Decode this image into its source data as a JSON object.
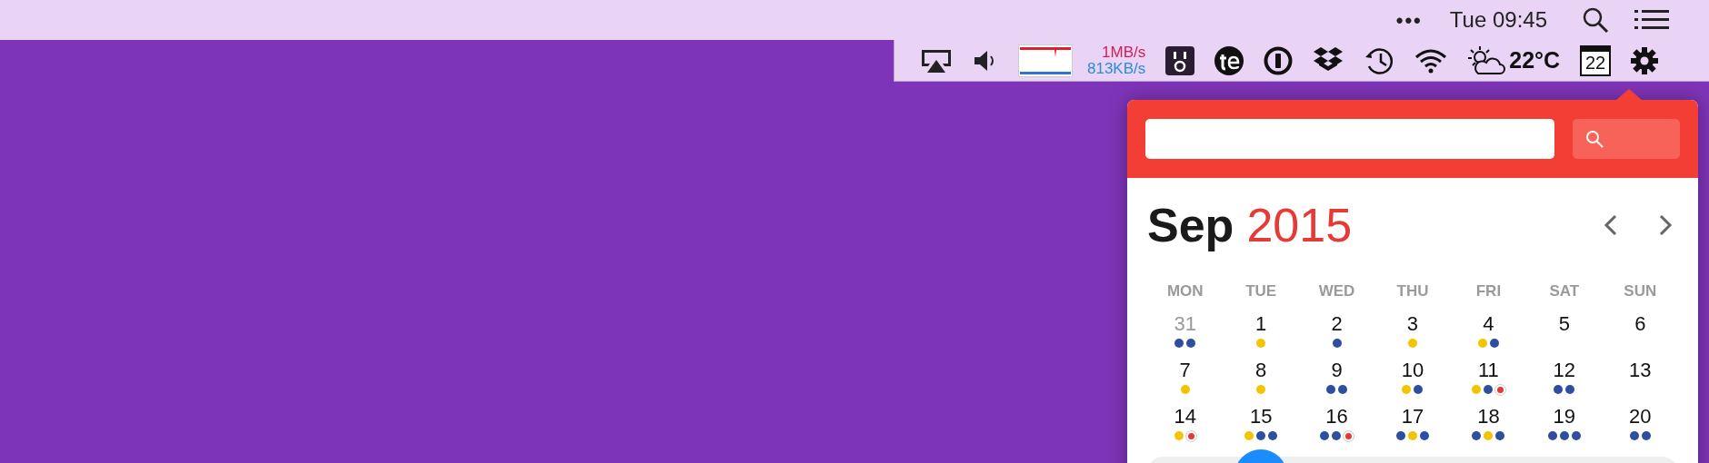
{
  "menu_bar": {
    "more": "•••",
    "clock": "Tue 09:45"
  },
  "status_bar": {
    "net_up": "1MB/s",
    "net_down": "813KB/s",
    "temperature": "22°C",
    "calendar_day": "22"
  },
  "calendar": {
    "month": "Sep",
    "year": "2015",
    "weekdays": [
      "MON",
      "TUE",
      "WED",
      "THU",
      "FRI",
      "SAT",
      "SUN"
    ],
    "weeks": [
      {
        "current": false,
        "days": [
          {
            "label": "31",
            "other_month": true,
            "selected": false,
            "dots": [
              {
                "kind": "dot",
                "color": "#2e4fa0"
              },
              {
                "kind": "dot",
                "color": "#2e4fa0"
              }
            ]
          },
          {
            "label": "1",
            "other_month": false,
            "selected": false,
            "dots": [
              {
                "kind": "dot",
                "color": "#f5c400"
              }
            ]
          },
          {
            "label": "2",
            "other_month": false,
            "selected": false,
            "dots": [
              {
                "kind": "dot",
                "color": "#2e4fa0"
              }
            ]
          },
          {
            "label": "3",
            "other_month": false,
            "selected": false,
            "dots": [
              {
                "kind": "dot",
                "color": "#f5c400"
              }
            ]
          },
          {
            "label": "4",
            "other_month": false,
            "selected": false,
            "dots": [
              {
                "kind": "dot",
                "color": "#f5c400"
              },
              {
                "kind": "dot",
                "color": "#2e4fa0"
              }
            ]
          },
          {
            "label": "5",
            "other_month": false,
            "selected": false
          },
          {
            "label": "6",
            "other_month": false,
            "selected": false
          }
        ]
      },
      {
        "current": false,
        "days": [
          {
            "label": "7",
            "other_month": false,
            "selected": false,
            "dots": [
              {
                "kind": "dot",
                "color": "#f5c400"
              }
            ]
          },
          {
            "label": "8",
            "other_month": false,
            "selected": false,
            "dots": [
              {
                "kind": "dot",
                "color": "#f5c400"
              }
            ]
          },
          {
            "label": "9",
            "other_month": false,
            "selected": false,
            "dots": [
              {
                "kind": "dot",
                "color": "#2e4fa0"
              },
              {
                "kind": "dot",
                "color": "#2e4fa0"
              }
            ]
          },
          {
            "label": "10",
            "other_month": false,
            "selected": false,
            "dots": [
              {
                "kind": "dot",
                "color": "#f5c400"
              },
              {
                "kind": "dot",
                "color": "#2e4fa0"
              }
            ]
          },
          {
            "label": "11",
            "other_month": false,
            "selected": false,
            "dots": [
              {
                "kind": "dot",
                "color": "#f5c400"
              },
              {
                "kind": "dot",
                "color": "#2e4fa0"
              },
              {
                "kind": "ring",
                "color": "#e53935"
              }
            ]
          },
          {
            "label": "12",
            "other_month": false,
            "selected": false,
            "dots": [
              {
                "kind": "dot",
                "color": "#2e4fa0"
              },
              {
                "kind": "dot",
                "color": "#2e4fa0"
              }
            ]
          },
          {
            "label": "13",
            "other_month": false,
            "selected": false
          }
        ]
      },
      {
        "current": false,
        "days": [
          {
            "label": "14",
            "other_month": false,
            "selected": false,
            "dots": [
              {
                "kind": "dot",
                "color": "#f5c400"
              },
              {
                "kind": "ring",
                "color": "#e53935"
              }
            ]
          },
          {
            "label": "15",
            "other_month": false,
            "selected": false,
            "dots": [
              {
                "kind": "dot",
                "color": "#f5c400"
              },
              {
                "kind": "dot",
                "color": "#2e4fa0"
              },
              {
                "kind": "dot",
                "color": "#2e4fa0"
              }
            ]
          },
          {
            "label": "16",
            "other_month": false,
            "selected": false,
            "dots": [
              {
                "kind": "dot",
                "color": "#2e4fa0"
              },
              {
                "kind": "dot",
                "color": "#2e4fa0"
              },
              {
                "kind": "ring",
                "color": "#e53935"
              }
            ]
          },
          {
            "label": "17",
            "other_month": false,
            "selected": false,
            "dots": [
              {
                "kind": "dot",
                "color": "#2e4fa0"
              },
              {
                "kind": "dot",
                "color": "#f5c400"
              },
              {
                "kind": "dot",
                "color": "#2e4fa0"
              }
            ]
          },
          {
            "label": "18",
            "other_month": false,
            "selected": false,
            "dots": [
              {
                "kind": "dot",
                "color": "#2e4fa0"
              },
              {
                "kind": "dot",
                "color": "#f5c400"
              },
              {
                "kind": "dot",
                "color": "#2e4fa0"
              }
            ]
          },
          {
            "label": "19",
            "other_month": false,
            "selected": false,
            "dots": [
              {
                "kind": "dot",
                "color": "#2e4fa0"
              },
              {
                "kind": "dot",
                "color": "#2e4fa0"
              },
              {
                "kind": "dot",
                "color": "#2e4fa0"
              }
            ]
          },
          {
            "label": "20",
            "other_month": false,
            "selected": false,
            "dots": [
              {
                "kind": "dot",
                "color": "#2e4fa0"
              },
              {
                "kind": "dot",
                "color": "#2e4fa0"
              }
            ]
          }
        ]
      },
      {
        "current": true,
        "days": [
          {
            "selected": false
          },
          {
            "selected": true
          },
          {
            "selected": false
          },
          {
            "selected": false
          },
          {
            "selected": false
          },
          {
            "selected": false
          },
          {
            "selected": false
          }
        ]
      }
    ]
  }
}
